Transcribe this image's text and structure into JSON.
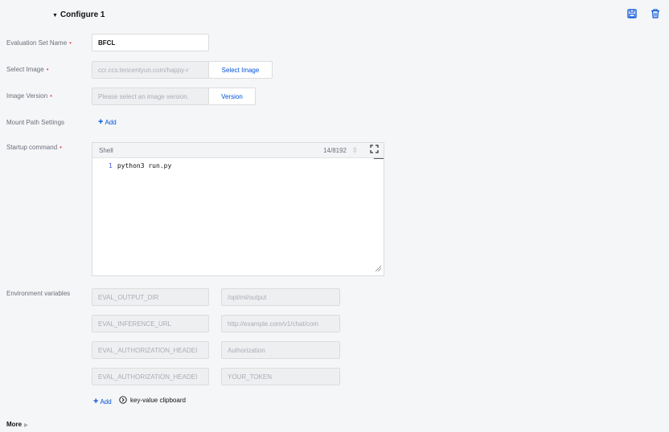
{
  "section": {
    "title": "Configure 1",
    "save_icon": "save-icon",
    "delete_icon": "trash-icon"
  },
  "fields": {
    "eval_set_name": {
      "label": "Evaluation Set Name",
      "value": "BFCL"
    },
    "select_image": {
      "label": "Select Image",
      "value": "ccr.ccs.tencentyun.com/happy-r",
      "button": "Select Image"
    },
    "image_version": {
      "label": "Image Version",
      "placeholder": "Please select an image version.",
      "button": "Version"
    },
    "mount_path": {
      "label": "Mount Path Settings",
      "add": "Add"
    },
    "startup": {
      "label": "Startup command",
      "language": "Shell",
      "counter": "14/8192",
      "line_number": "1",
      "code": "python3 run.py"
    },
    "env": {
      "label": "Environment variables",
      "rows": [
        {
          "key": "EVAL_OUTPUT_DIR",
          "value": "/opt/ml/output"
        },
        {
          "key": "EVAL_INFERENCE_URL",
          "value": "http://example.com/v1/chat/com"
        },
        {
          "key": "EVAL_AUTHORIZATION_HEADEI",
          "value": "Authorization"
        },
        {
          "key": "EVAL_AUTHORIZATION_HEADEI",
          "value": "YOUR_TOKEN"
        }
      ],
      "add": "Add",
      "clipboard": "key-value clipboard"
    }
  },
  "more": "More",
  "colors": {
    "accent": "#0052d9",
    "required": "#e34d59"
  }
}
